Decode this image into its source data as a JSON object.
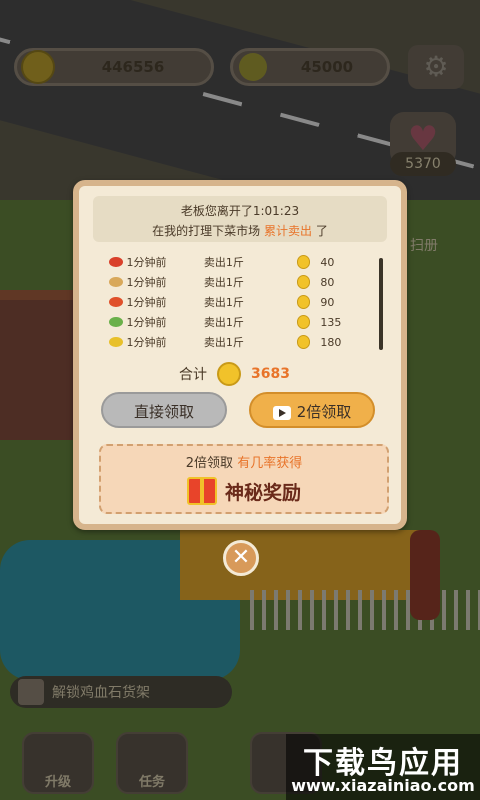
{
  "topbar": {
    "coins": "446556",
    "gems": "45000",
    "hearts": "5370",
    "side_label": "扫册"
  },
  "dialog": {
    "header_line1": "老板您离开了1:01:23",
    "header_prefix": "在我的打理下菜市场",
    "header_highlight": "累计卖出",
    "header_suffix": "了",
    "sales": [
      {
        "veg": "tomato",
        "color": "#d9402a",
        "time": "1分钟前",
        "action": "卖出1斤",
        "amount": "40"
      },
      {
        "veg": "potato",
        "color": "#d8a85a",
        "time": "1分钟前",
        "action": "卖出1斤",
        "amount": "80"
      },
      {
        "veg": "carrot",
        "color": "#e0502a",
        "time": "1分钟前",
        "action": "卖出1斤",
        "amount": "90"
      },
      {
        "veg": "cucumber",
        "color": "#6ab04a",
        "time": "1分钟前",
        "action": "卖出1斤",
        "amount": "135"
      },
      {
        "veg": "corn",
        "color": "#e8c02a",
        "time": "1分钟前",
        "action": "卖出1斤",
        "amount": "180"
      }
    ],
    "total_label": "合计",
    "total_value": "3683",
    "btn_direct": "直接领取",
    "btn_double": "2倍领取",
    "reward_prefix": "2倍领取",
    "reward_highlight": "有几率获得",
    "reward_title": "神秘奖励",
    "close": "✕"
  },
  "bottom": {
    "task_text": "解锁鸡血石货架",
    "upgrade": "升级",
    "task": "任务",
    "watermark_title": "下载鸟应用",
    "watermark_url": "www.xiazainiao.com"
  }
}
